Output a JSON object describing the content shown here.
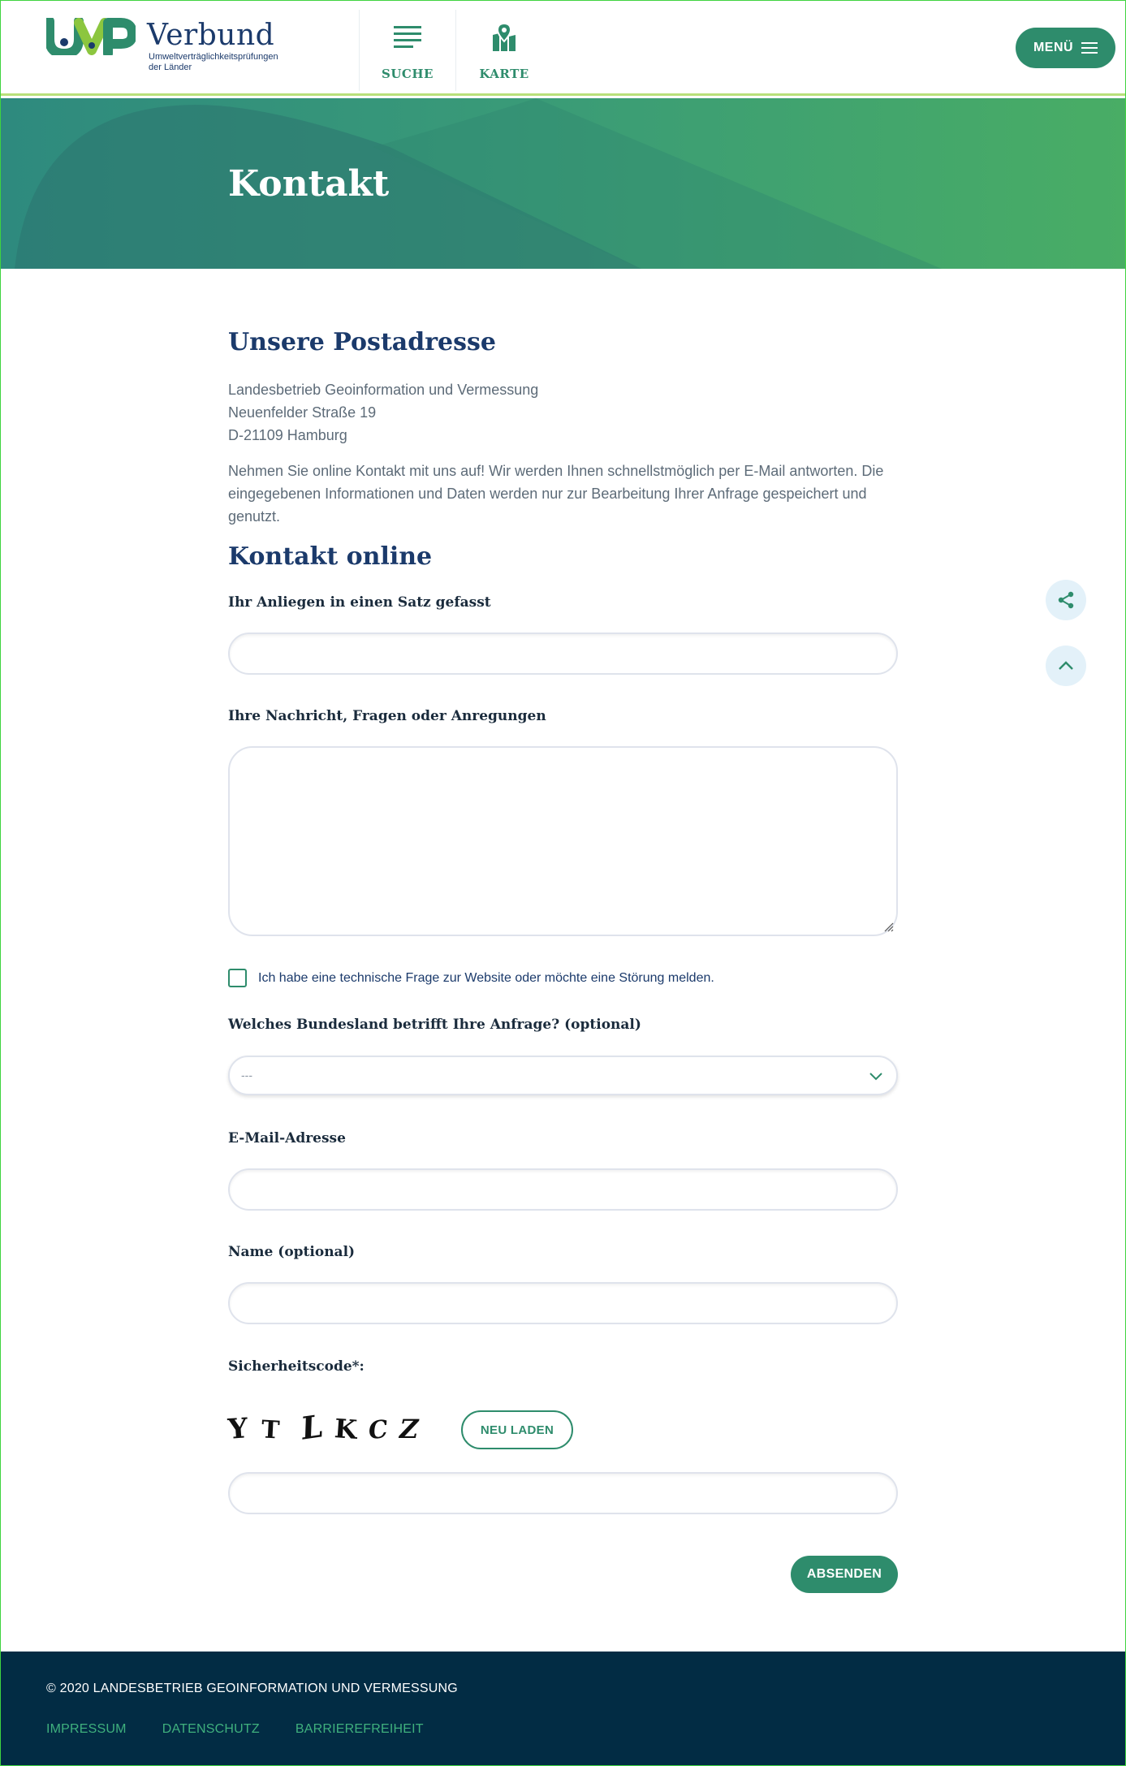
{
  "header": {
    "logo_mark": "UVP",
    "logo_name": "Verbund",
    "logo_sub_line1": "Umweltverträglichkeitsprüfungen",
    "logo_sub_line2": "der Länder",
    "nav": [
      {
        "label": "SUCHE",
        "icon": "list-search-icon"
      },
      {
        "label": "KARTE",
        "icon": "map-pin-icon"
      }
    ],
    "menu_label": "MENÜ"
  },
  "hero": {
    "title": "Kontakt"
  },
  "address": {
    "heading": "Unsere Postadresse",
    "line1": "Landesbetrieb Geoinformation und Vermessung",
    "line2": "Neuenfelder Straße 19",
    "line3": "D-21109 Hamburg"
  },
  "intro": "Nehmen Sie online Kontakt mit uns auf! Wir werden Ihnen schnellstmöglich per E-Mail antworten. Die eingegebenen Informationen und Daten werden nur zur Bearbeitung Ihrer Anfrage gespeichert und genutzt.",
  "form": {
    "heading": "Kontakt online",
    "subject_label": "Ihr Anliegen in einen Satz gefasst",
    "subject_value": "",
    "message_label": "Ihre Nachricht, Fragen oder Anregungen",
    "message_value": "",
    "technical_checkbox_label": "Ich habe eine technische Frage zur Website oder möchte eine Störung melden.",
    "technical_checked": false,
    "state_label": "Welches Bundesland betrifft Ihre Anfrage? (optional)",
    "state_selected": "---",
    "email_label": "E-Mail-Adresse",
    "email_value": "",
    "name_label": "Name (optional)",
    "name_value": "",
    "captcha_label": "Sicherheitscode*:",
    "captcha_chars": [
      "Y",
      "T",
      "L",
      "K",
      "C",
      "Z"
    ],
    "reload_label": "NEU LADEN",
    "captcha_value": "",
    "submit_label": "ABSENDEN"
  },
  "side_actions": [
    {
      "icon": "share-icon"
    },
    {
      "icon": "chevron-up-icon"
    }
  ],
  "footer": {
    "copyright": "© 2020 LANDESBETRIEB GEOINFORMATION UND VERMESSUNG",
    "links": [
      "IMPRESSUM",
      "DATENSCHUTZ",
      "BARRIEREFREIHEIT"
    ]
  },
  "colors": {
    "accent": "#2e8c6c",
    "heading": "#1b3a6b",
    "footer_bg": "#022c44",
    "footer_link": "#3fb07d"
  }
}
